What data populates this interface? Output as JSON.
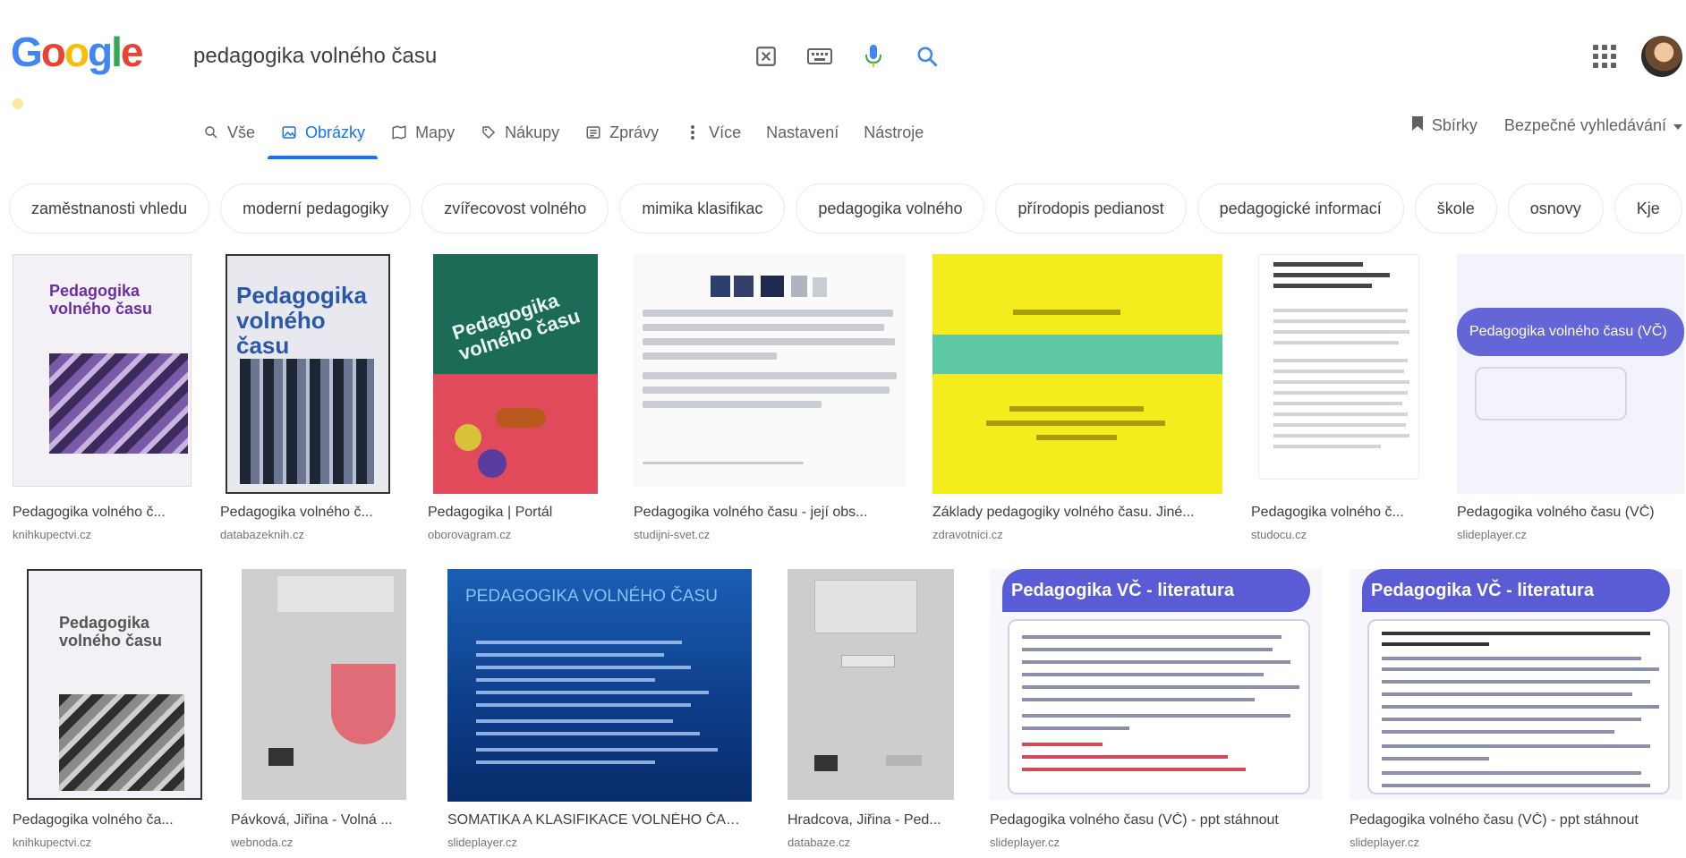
{
  "search": {
    "query": "pedagogika volného času"
  },
  "tabs": [
    {
      "label": "Vše",
      "icon": "search-icon"
    },
    {
      "label": "Obrázky",
      "icon": "image-icon",
      "active": true
    },
    {
      "label": "Mapy",
      "icon": "map-icon"
    },
    {
      "label": "Nákupy",
      "icon": "tag-icon"
    },
    {
      "label": "Zprávy",
      "icon": "news-icon"
    },
    {
      "label": "Více",
      "icon": "more-icon"
    },
    {
      "label": "Nastavení"
    },
    {
      "label": "Nástroje"
    }
  ],
  "tools_right": {
    "collections": "Sbírky",
    "safesearch": "Bezpečné vyhledávání"
  },
  "chips": [
    "zaměstnanosti vhledu",
    "moderní pedagogiky",
    "zvířecovost volného",
    "mimika klasifikac",
    "pedagogika volného",
    "přírodopis pedianost",
    "pedagogické informací",
    "škole",
    "osnovy",
    "Kje"
  ],
  "row1": [
    {
      "title": "Pedagogika volného č...",
      "source": "knihkupectvi.cz",
      "thumb_title": "Pedagogika volného času"
    },
    {
      "title": "Pedagogika volného č...",
      "source": "databazeknih.cz",
      "thumb_title": "Pedagogika volného času"
    },
    {
      "title": "Pedagogika | Portál",
      "source": "oborovagram.cz",
      "thumb_title": "Pedagogika volného času"
    },
    {
      "title": "Pedagogika volného času - její obs...",
      "source": "studijni-svet.cz"
    },
    {
      "title": "Základy pedagogiky volného času. Jiné...",
      "source": "zdravotnici.cz"
    },
    {
      "title": "Pedagogika volného č...",
      "source": "studocu.cz"
    },
    {
      "title": "Pedagogika volného času (VČ)",
      "source": "slideplayer.cz",
      "thumb_title": "Pedagogika volného času (VČ)"
    }
  ],
  "row2": [
    {
      "title": "Pedagogika volného ča...",
      "source": "knihkupectvi.cz",
      "thumb_title": "Pedagogika volného času"
    },
    {
      "title": "Pávková, Jiřina - Volná ...",
      "source": "webnoda.cz"
    },
    {
      "title": "SOMATIKA A KLASIFIKACE VOLNÉHO ČASU...",
      "source": "slideplayer.cz",
      "thumb_title": "PEDAGOGIKA VOLNÉHO ČASU"
    },
    {
      "title": "Hradcova, Jiřina - Ped...",
      "source": "databaze.cz"
    },
    {
      "title": "Pedagogika volného času (VČ) - ppt stáhnout",
      "source": "slideplayer.cz",
      "thumb_title": "Pedagogika VČ - literatura"
    },
    {
      "title": "Pedagogika volného času (VČ) - ppt stáhnout",
      "source": "slideplayer.cz",
      "thumb_title": "Pedagogika VČ - literatura"
    }
  ],
  "colors": {
    "accent": "#1a73e8",
    "chip_border": "#e8eaed",
    "slide_purple": "#5a5cd6"
  }
}
